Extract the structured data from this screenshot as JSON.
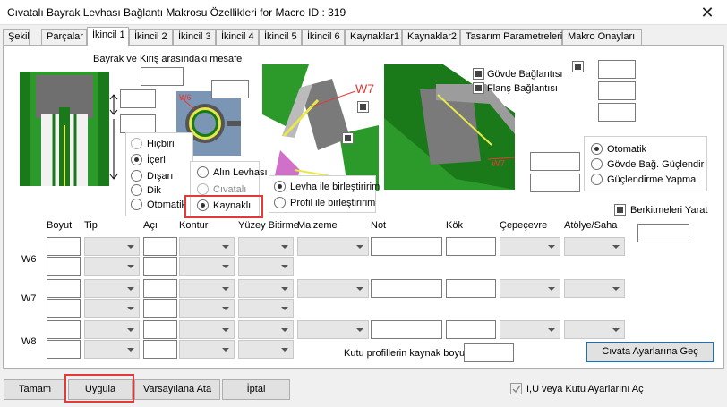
{
  "window": {
    "title": "Cıvatalı Bayrak Levhası Bağlantı Makrosu Özellikleri for Macro ID : 319",
    "close": "✕"
  },
  "tabs": [
    "Şekil",
    "Parçalar",
    "İkincil 1",
    "İkincil 2",
    "İkincil 3",
    "İkincil 4",
    "İkincil 5",
    "İkincil 6",
    "Kaynaklar1",
    "Kaynaklar2",
    "Tasarım Parametreleri",
    "Makro Onayları"
  ],
  "top": {
    "distance_label": "Bayrak ve Kiriş arasındaki mesafe"
  },
  "image_labels": {
    "w6": "W6",
    "w7": "W7",
    "w7b": "W7"
  },
  "connections": {
    "body": "Gövde Bağlantısı",
    "flange": "Flanş Bağlantısı"
  },
  "placement_radios": [
    "Hiçbiri",
    "İçeri",
    "Dışarı",
    "Dik",
    "Otomatik"
  ],
  "plate_radios": [
    "Alın Levhası",
    "Cıvatalı",
    "Kaynaklı"
  ],
  "joint_radios": [
    "Levha ile birleştiririm",
    "Profil ile birleştiririm"
  ],
  "stiffener_radios": [
    "Otomatik",
    "Gövde Bağ. Güçlendir",
    "Güçlendirme Yapma"
  ],
  "stiffener_check": "Berkitmeleri Yarat",
  "weld_headers": [
    "Boyut",
    "Tip",
    "Açı",
    "Kontur",
    "Yüzey Bitirme",
    "Malzeme",
    "Not",
    "Kök",
    "Çepeçevre",
    "Atölye/Saha"
  ],
  "weld_rows": [
    "W6",
    "W7",
    "W8"
  ],
  "tube_label": "Kutu profillerin kaynak boyu",
  "bolt_button": "Cıvata Ayarlarına Geç",
  "bottom": {
    "ok": "Tamam",
    "apply": "Uygula",
    "defaults": "Varsayılana Ata",
    "cancel": "İptal",
    "iu_check": "I,U veya Kutu Ayarlarını Aç"
  },
  "colors": {
    "highlight": "#e53935",
    "green": "#1a7a1a",
    "steel": "#7a96b4"
  }
}
